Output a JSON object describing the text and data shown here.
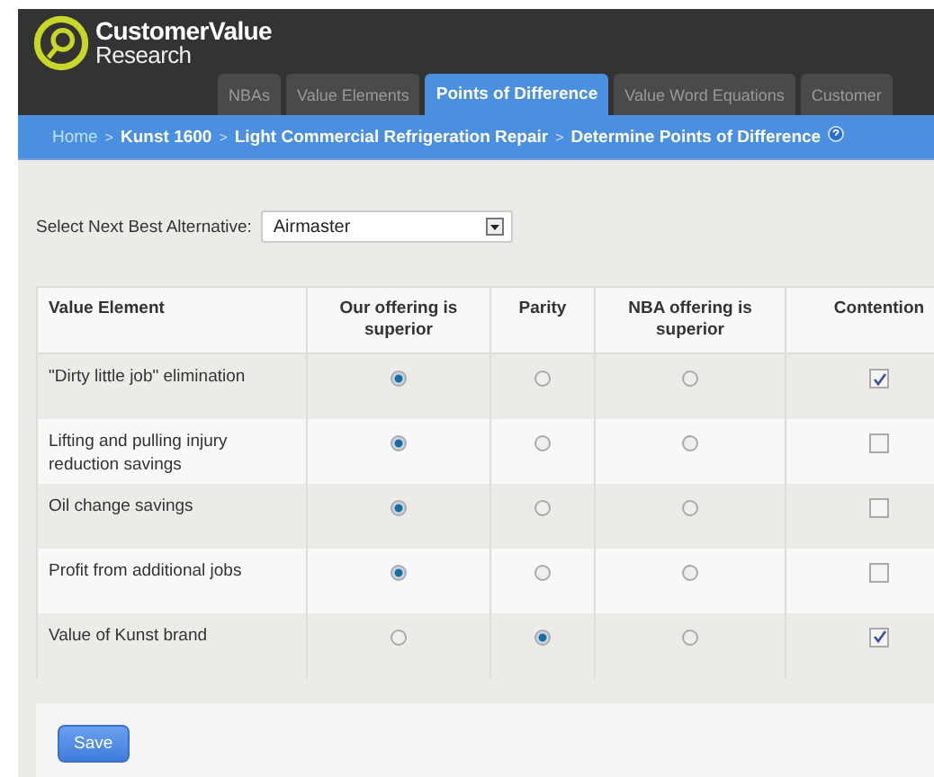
{
  "logo": {
    "line1": "CustomerValue",
    "line2": "Research"
  },
  "tabs": [
    {
      "label": "NBAs",
      "selected": false
    },
    {
      "label": "Value Elements",
      "selected": false
    },
    {
      "label": "Points of Difference",
      "selected": true
    },
    {
      "label": "Value Word Equations",
      "selected": false
    },
    {
      "label": "Customer",
      "selected": false
    }
  ],
  "breadcrumb": [
    {
      "label": "Home",
      "kind": "link"
    },
    {
      "label": "Kunst 1600",
      "kind": "crumb"
    },
    {
      "label": "Light Commercial Refrigeration Repair",
      "kind": "crumb"
    },
    {
      "label": "Determine Points of Difference",
      "kind": "current"
    }
  ],
  "breadcrumb_separator": ">",
  "alternative": {
    "label": "Select Next Best Alternative:",
    "value": "Airmaster"
  },
  "table": {
    "columns": [
      "Value Element",
      "Our offering is superior",
      "Parity",
      "NBA offering is superior",
      "Contention"
    ],
    "rows": [
      {
        "name": "\"Dirty little job\" elimination",
        "choices": [
          {
            "selected": true
          },
          {
            "selected": false
          },
          {
            "selected": false
          }
        ],
        "contention": true
      },
      {
        "name": "Lifting and pulling injury reduction savings",
        "choices": [
          {
            "selected": true
          },
          {
            "selected": false
          },
          {
            "selected": false
          }
        ],
        "contention": false
      },
      {
        "name": "Oil change savings",
        "choices": [
          {
            "selected": true
          },
          {
            "selected": false
          },
          {
            "selected": false
          }
        ],
        "contention": false
      },
      {
        "name": "Profit from additional jobs",
        "choices": [
          {
            "selected": true
          },
          {
            "selected": false
          },
          {
            "selected": false
          }
        ],
        "contention": false
      },
      {
        "name": "Value of Kunst brand",
        "choices": [
          {
            "selected": false
          },
          {
            "selected": true
          },
          {
            "selected": false
          }
        ],
        "contention": true
      }
    ]
  },
  "save_button": "Save"
}
